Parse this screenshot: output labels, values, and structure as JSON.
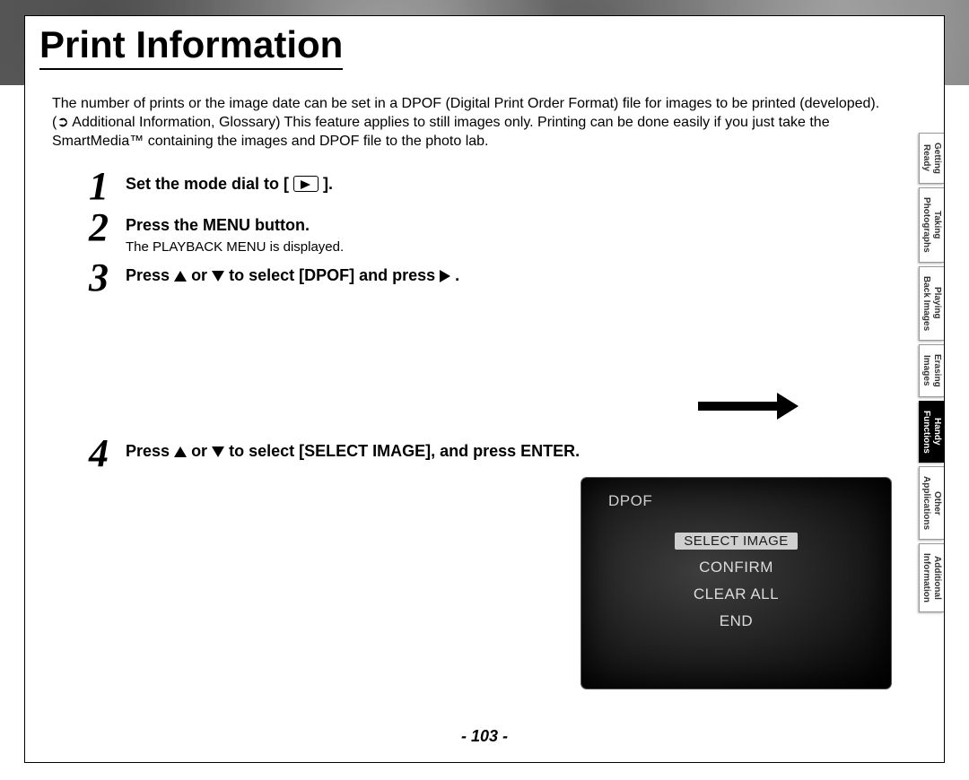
{
  "title": "Print Information",
  "intro": "The number of prints or the image date can be set in a DPOF (Digital Print Order Format) file for images to be printed (developed). (➲ Additional Information, Glossary) This feature applies to still images only. Printing can be done easily if you just take the SmartMedia™ containing the images and DPOF file to the photo lab.",
  "steps": {
    "s1_pre": "Set the mode dial to [",
    "s1_post": " ].",
    "s2": "Press the MENU button.",
    "s2_sub": "The PLAYBACK MENU is displayed.",
    "s3_a": "Press ",
    "s3_b": " or ",
    "s3_c": " to select [DPOF] and press ",
    "s3_d": ".",
    "s4_a": "Press ",
    "s4_b": " or ",
    "s4_c": " to select [SELECT IMAGE], and press ENTER."
  },
  "lcd": {
    "title": "DPOF",
    "items": [
      "SELECT IMAGE",
      "CONFIRM",
      "CLEAR ALL",
      "END"
    ],
    "selected": 0
  },
  "page_number": "- 103 -",
  "tabs": [
    {
      "line1": "Getting",
      "line2": "Ready",
      "active": false
    },
    {
      "line1": "Taking",
      "line2": "Photographs",
      "active": false
    },
    {
      "line1": "Playing",
      "line2": "Back Images",
      "active": false
    },
    {
      "line1": "Erasing",
      "line2": "Images",
      "active": false
    },
    {
      "line1": "Handy",
      "line2": "Functions",
      "active": true
    },
    {
      "line1": "Other",
      "line2": "Applications",
      "active": false
    },
    {
      "line1": "Additional",
      "line2": "Information",
      "active": false
    }
  ]
}
